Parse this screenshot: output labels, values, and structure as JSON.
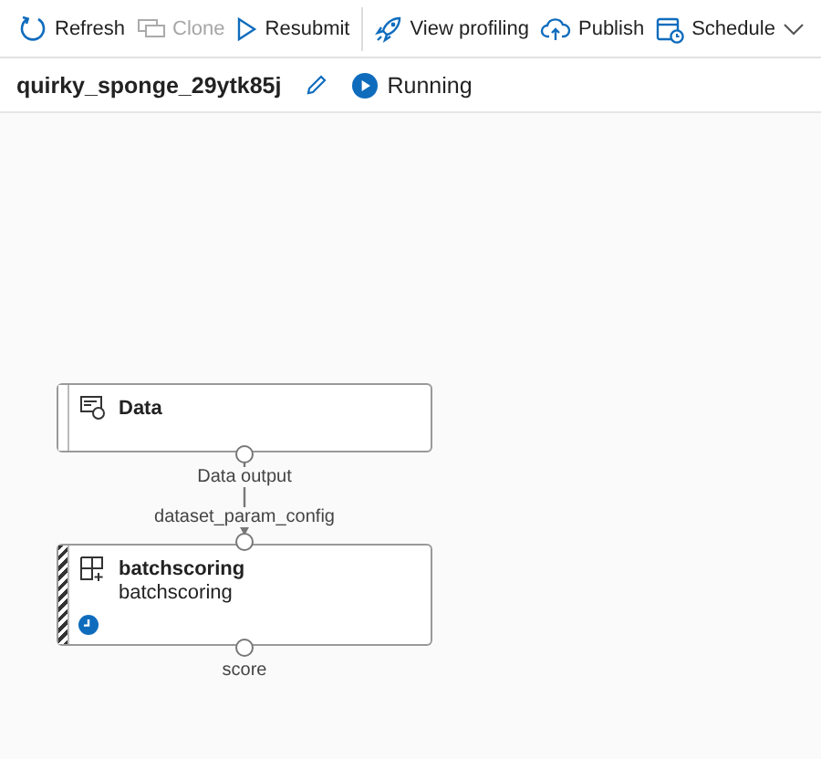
{
  "toolbar": {
    "groups": [
      [
        {
          "label": "Refresh",
          "disabled": false
        },
        {
          "label": "Clone",
          "disabled": true
        },
        {
          "label": "Resubmit",
          "disabled": false
        }
      ],
      [
        {
          "label": "View profiling",
          "disabled": false
        },
        {
          "label": "Publish",
          "disabled": false
        },
        {
          "label": "Schedule",
          "disabled": false,
          "dropdown": true
        }
      ]
    ]
  },
  "run": {
    "name": "quirky_sponge_29ytk85j",
    "status": "Running"
  },
  "pipeline": {
    "nodes": [
      {
        "kind": "dataset",
        "title": "Data",
        "running": false,
        "outputs": [
          "Data output"
        ]
      },
      {
        "kind": "module",
        "title": "batchscoring",
        "subtitle": "batchscoring",
        "running": true,
        "inputs": [
          "dataset_param_config"
        ],
        "outputs": [
          "score"
        ]
      }
    ]
  }
}
